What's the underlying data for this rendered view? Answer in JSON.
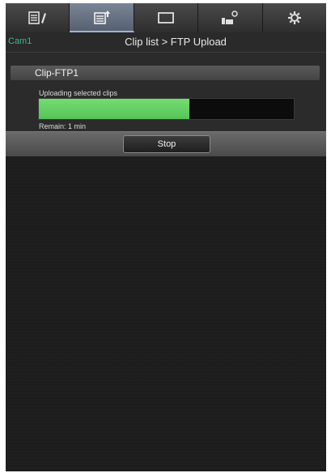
{
  "tabs": [
    {
      "icon": "clip-edit-icon",
      "active": false
    },
    {
      "icon": "clip-upload-icon",
      "active": true
    },
    {
      "icon": "monitor-icon",
      "active": false
    },
    {
      "icon": "camera-settings-icon",
      "active": false
    },
    {
      "icon": "gear-icon",
      "active": false
    }
  ],
  "header": {
    "camera": "Cam1",
    "title": "Clip list > FTP Upload"
  },
  "upload": {
    "clip_name": "Clip-FTP1",
    "status": "Uploading selected clips",
    "progress": 0.59,
    "remain": "Remain: 1 min"
  },
  "buttons": {
    "stop": "Stop"
  },
  "colors": {
    "progress_fill": "#62cc60",
    "camera_label": "#3fb48c",
    "active_tab": "#6c788a"
  }
}
